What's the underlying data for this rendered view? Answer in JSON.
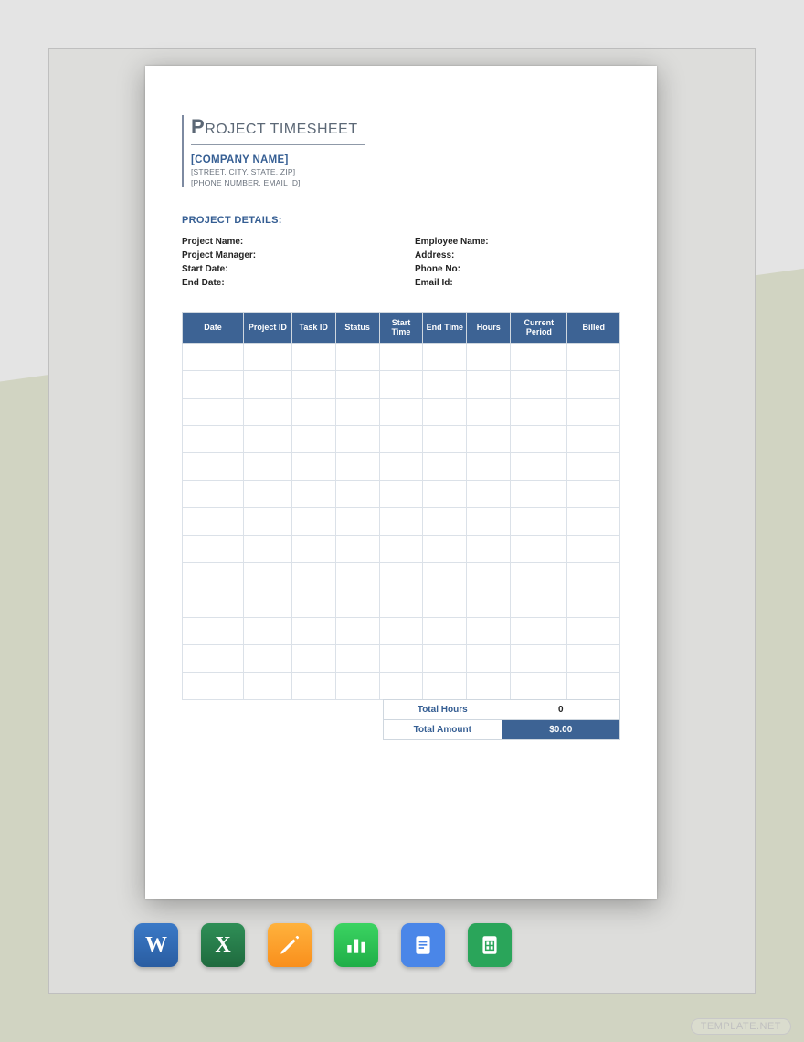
{
  "document": {
    "title_first_letter": "P",
    "title_rest": "ROJECT TIMESHEET",
    "company_name": "[COMPANY NAME]",
    "address_line": "[STREET, CITY, STATE, ZIP]",
    "contact_line": "[PHONE NUMBER, EMAIL ID]",
    "section_heading": "PROJECT DETAILS:",
    "left_fields": {
      "project_name": "Project Name:",
      "project_manager": "Project Manager:",
      "start_date": "Start Date:",
      "end_date": "End Date:"
    },
    "right_fields": {
      "employee_name": "Employee Name:",
      "address": "Address:",
      "phone_no": "Phone No:",
      "email_id": "Email Id:"
    },
    "columns": [
      "Date",
      "Project ID",
      "Task ID",
      "Status",
      "Start Time",
      "End Time",
      "Hours",
      "Current Period",
      "Billed"
    ],
    "row_count": 13,
    "totals": {
      "hours_label": "Total Hours",
      "hours_value": "0",
      "amount_label": "Total Amount",
      "amount_value": "$0.00"
    }
  },
  "formats": {
    "word": "Microsoft Word",
    "excel": "Microsoft Excel",
    "pages": "Apple Pages",
    "numbers": "Apple Numbers",
    "gdoc": "Google Docs",
    "gsheet": "Google Sheets"
  },
  "watermark": "TEMPLATE.NET"
}
